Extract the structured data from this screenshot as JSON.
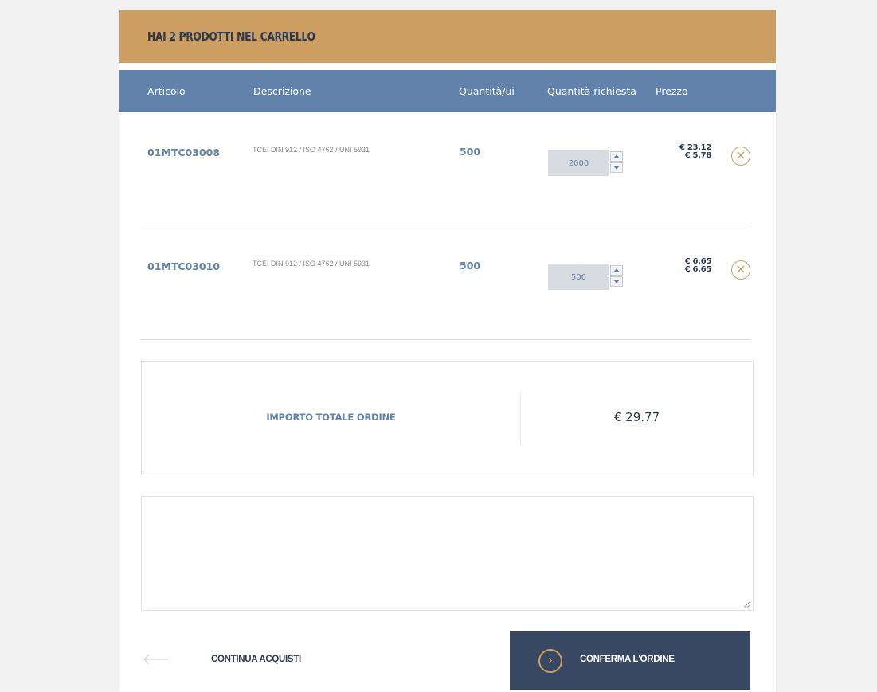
{
  "cart": {
    "title": "HAI 2 PRODOTTI NEL CARRELLO"
  },
  "table": {
    "headers": {
      "article": "Articolo",
      "description": "Descrizione",
      "qty_ui": "Quantità/ui",
      "qty_requested": "Quantità richiesta",
      "price": "Prezzo"
    },
    "rows": [
      {
        "code": "01MTC03008",
        "description": "TCEI DIN 912 / ISO 4762 / UNI 5931",
        "qty_ui": "500",
        "qty_requested": "2000",
        "price_total": "€ 23.12",
        "price_unit": "€ 5.78",
        "remove_icon": "×"
      },
      {
        "code": "01MTC03010",
        "description": "TCEI DIN 912 / ISO 4762 / UNI 5931",
        "qty_ui": "500",
        "qty_requested": "500",
        "price_total": "€ 6.65",
        "price_unit": "€ 6.65",
        "remove_icon": "×"
      }
    ]
  },
  "total": {
    "label": "IMPORTO TOTALE ORDINE",
    "value": "€ 29.77"
  },
  "notes": {
    "value": ""
  },
  "actions": {
    "continue_label": "CONTINUA ACQUISTI",
    "confirm_label": "CONFERMA L'ORDINE",
    "confirm_icon": "›"
  },
  "colors": {
    "header_bg": "#cd9e62",
    "table_head_bg": "#6183ab",
    "accent": "#cd9e62",
    "primary_text": "#2f3a52",
    "link_blue": "#6183ab",
    "confirm_bg": "#394862"
  },
  "icons": {
    "remove": "close-circle-icon",
    "continue": "arrow-left-icon",
    "confirm": "chevron-right-circle-icon"
  }
}
